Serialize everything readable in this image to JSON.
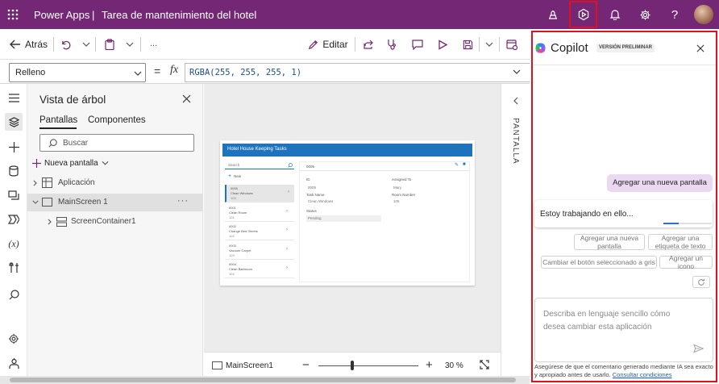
{
  "topbar": {
    "app_name": "Power Apps",
    "separator": "|",
    "doc_title": "Tarea de mantenimiento del hotel",
    "icons": [
      "health-monitor-icon",
      "copilot-play-icon",
      "bell-icon",
      "gear-icon",
      "help-icon",
      "avatar"
    ]
  },
  "commandbar": {
    "back_label": "Atrás",
    "more_label": "...",
    "edit_label": "Editar"
  },
  "formulabar": {
    "property": "Relleno",
    "equals": "=",
    "fx": "fx",
    "formula": "RGBA(255, 255, 255, 1)"
  },
  "tree": {
    "title": "Vista de árbol",
    "tabs": [
      "Pantallas",
      "Componentes"
    ],
    "search_placeholder": "Buscar",
    "new_screen_label": "Nueva pantalla",
    "items": [
      {
        "label": "Aplicación"
      },
      {
        "label": "MainScreen 1",
        "more": "···"
      },
      {
        "label": "ScreenContainer1"
      }
    ]
  },
  "canvas": {
    "app_title": "Hotel House Keeping Tasks",
    "search_placeholder": "Search",
    "new_label": "New",
    "list": [
      {
        "id": "0005",
        "name": "Clean Windows",
        "num": "105"
      },
      {
        "id": "0001",
        "name": "Clean Room",
        "num": "101"
      },
      {
        "id": "0002",
        "name": "Change Bed Sheets",
        "num": "102"
      },
      {
        "id": "0003",
        "name": "Vacuum Carpet",
        "num": "103"
      },
      {
        "id": "0004",
        "name": "Clean Bathroom",
        "num": "104"
      }
    ],
    "detail": {
      "header_id": "0005",
      "id_label": "ID",
      "id_value": "0005",
      "assigned_label": "Assigned To",
      "assigned_value": "Mary",
      "task_label": "Task Name",
      "task_value": "Clean Windows",
      "room_label": "Room Number",
      "room_value": "105",
      "status_label": "Status",
      "status_value": "Pending"
    }
  },
  "zoombar": {
    "screen_name": "MainScreen1",
    "minus": "−",
    "plus": "+",
    "zoom": "30 %",
    "zoom_level": 0.3
  },
  "propcol": {
    "label": "PANTALLA"
  },
  "copilot": {
    "title": "Copilot",
    "badge": "VERSIÓN PRELIMINAR",
    "user_message": "Agregar una nueva pantalla",
    "status_message": "Estoy trabajando en ello...",
    "progress": 0.32,
    "suggestions": [
      "Agregar una nueva pantalla",
      "Agregar una etiqueta de texto",
      "Cambiar el botón seleccionado a gris",
      "Agregar un icono"
    ],
    "input_placeholder": "Describa en lenguaje sencillo cómo desea cambiar esta aplicación",
    "disclaimer": "Asegúrese de que el comentario generado mediante IA sea exacto y apropiado antes de usarlo.",
    "terms_link": "Consultar condiciones"
  },
  "colors": {
    "brand": "#742774",
    "highlight": "#e0101e",
    "app_header": "#1e73be"
  }
}
